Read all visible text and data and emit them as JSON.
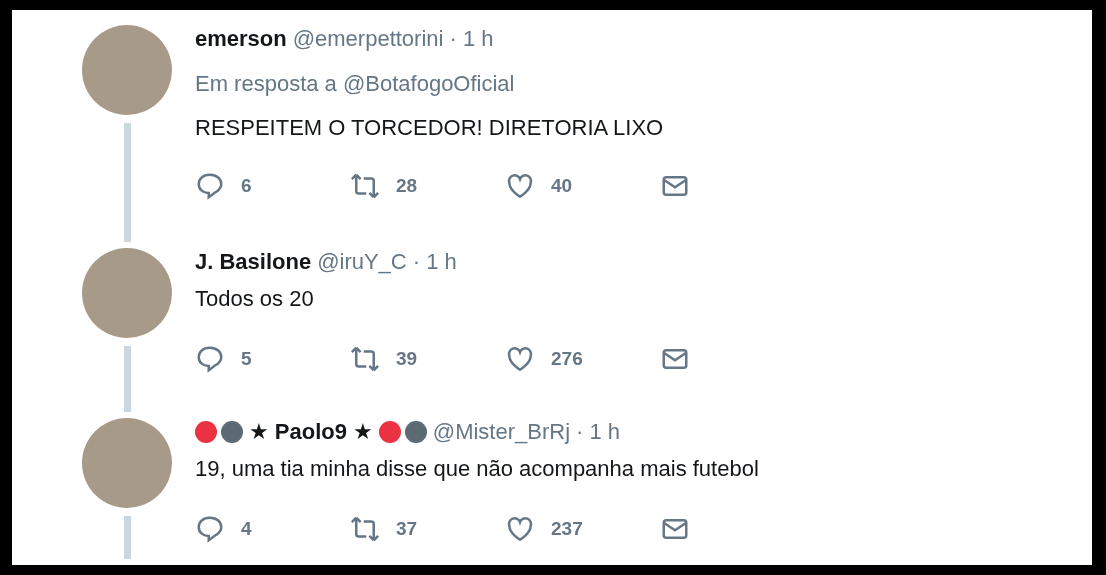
{
  "tweets": [
    {
      "name": "emerson",
      "handle": "@emerpettorini",
      "time": "· 1 h",
      "reply_to": "Em resposta a @BotafogoOficial",
      "text": "RESPEITEM O TORCEDOR! DIRETORIA LIXO",
      "replies": "6",
      "retweets": "28",
      "likes": "40"
    },
    {
      "name": "J. Basilone",
      "handle": "@iruY_C",
      "time": "· 1 h",
      "text": "Todos os 20",
      "replies": "5",
      "retweets": "39",
      "likes": "276"
    },
    {
      "name": "★ Paolo9 ★",
      "name_dots_before": [
        {
          "color": "#ec3344"
        },
        {
          "color": "#5c6b73"
        }
      ],
      "name_dots_after": [
        {
          "color": "#ec3344"
        },
        {
          "color": "#5c6b73"
        }
      ],
      "handle": "@Mister_BrRj",
      "time": "· 1 h",
      "text": "19, uma tia minha disse que não acompanha mais futebol",
      "replies": "4",
      "retweets": "37",
      "likes": "237"
    }
  ]
}
